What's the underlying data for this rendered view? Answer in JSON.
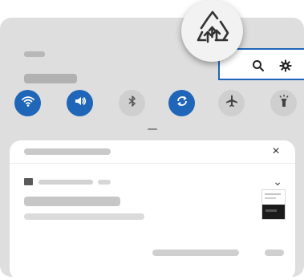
{
  "window": {
    "close_glyph": "×",
    "chevron_glyph": "⌄"
  },
  "colors": {
    "accent": "#1f66b8",
    "panel": "#dedede",
    "card": "#ffffff"
  },
  "quick_settings": [
    {
      "name": "wifi",
      "state": "on",
      "icon": "wifi-icon"
    },
    {
      "name": "sound",
      "state": "on",
      "icon": "volume-icon"
    },
    {
      "name": "bluetooth",
      "state": "off",
      "icon": "bluetooth-icon"
    },
    {
      "name": "auto-rotate",
      "state": "on",
      "icon": "rotate-icon"
    },
    {
      "name": "airplane",
      "state": "off",
      "icon": "airplane-icon"
    },
    {
      "name": "flashlight",
      "state": "off",
      "icon": "flashlight-icon"
    }
  ],
  "header_icons": [
    "search-icon",
    "gear-icon"
  ],
  "magnifier_icon": "smart-switch-icon"
}
